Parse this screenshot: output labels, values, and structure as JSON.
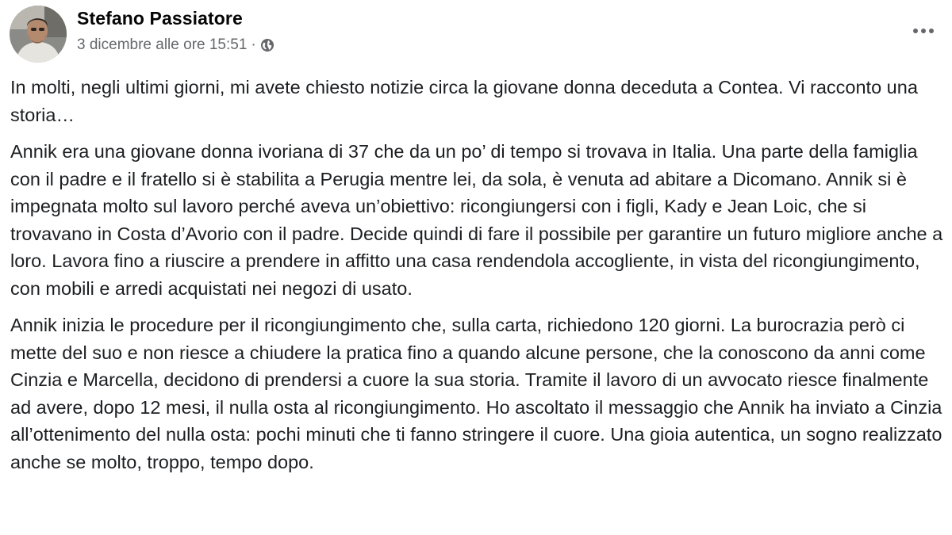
{
  "post": {
    "author": "Stefano Passiatore",
    "timestamp": "3 dicembre alle ore 15:51",
    "separator": "·",
    "audience_icon": "globe-icon",
    "more_icon": "more-options-icon",
    "paragraphs": [
      "In molti, negli ultimi giorni, mi avete chiesto notizie circa la giovane donna deceduta a Contea. Vi racconto una storia…",
      "Annik era una giovane donna ivoriana di 37 che da un po’ di tempo si trovava in Italia. Una parte della famiglia con il padre e il fratello si è stabilita a Perugia mentre lei, da sola, è venuta ad abitare a Dicomano. Annik si è impegnata molto sul lavoro perché aveva un’obiettivo: ricongiungersi con i figli, Kady e Jean Loic, che si trovavano in Costa d’Avorio con il padre. Decide quindi di fare il possibile per garantire un futuro migliore anche a loro. Lavora fino a riuscire a prendere in affitto una casa rendendola accogliente, in vista del ricongiungimento, con mobili e arredi acquistati nei negozi di usato.",
      "Annik inizia le procedure per il ricongiungimento che, sulla carta, richiedono 120 giorni. La burocrazia però ci mette del suo e non riesce a chiudere la pratica fino a quando alcune persone, che la conoscono da anni come Cinzia e Marcella, decidono di prendersi a cuore la sua storia. Tramite il lavoro di un avvocato riesce finalmente ad avere, dopo 12 mesi, il nulla osta al ricongiungimento. Ho ascoltato il messaggio che Annik ha inviato a Cinzia all’ottenimento del nulla osta: pochi minuti che ti fanno stringere il cuore. Una gioia autentica, un sogno realizzato anche se molto, troppo, tempo dopo."
    ]
  }
}
